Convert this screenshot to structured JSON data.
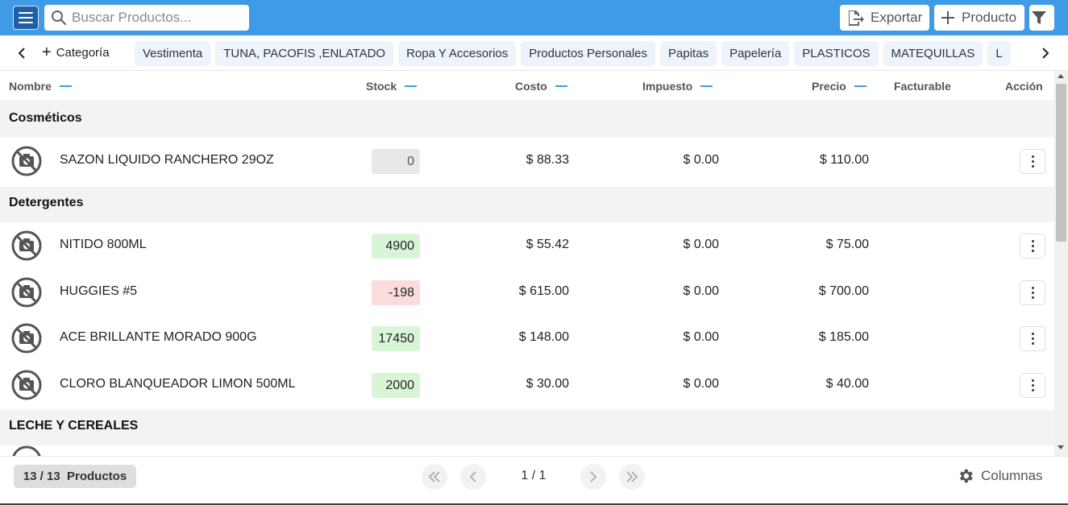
{
  "topbar": {
    "search_placeholder": "Buscar Productos...",
    "export_label": "Exportar",
    "product_label": "Producto"
  },
  "categories": {
    "add_label": "Categoría",
    "items": [
      "Vestimenta",
      "TUNA, PACOFIS ,ENLATADO",
      "Ropa Y Accesorios",
      "Productos Personales",
      "Papitas",
      "Papelería",
      "PLASTICOS",
      "MATEQUILLAS",
      "L"
    ]
  },
  "table": {
    "headers": {
      "nombre": "Nombre",
      "stock": "Stock",
      "costo": "Costo",
      "impuesto": "Impuesto",
      "precio": "Precio",
      "facturable": "Facturable",
      "accion": "Acción"
    },
    "groups": [
      {
        "name": "Cosméticos",
        "rows": [
          {
            "name": "SAZON LIQUIDO RANCHERO 29OZ",
            "stock": "0",
            "stock_state": "zero",
            "costo": "$ 88.33",
            "impuesto": "$ 0.00",
            "precio": "$ 110.00"
          }
        ]
      },
      {
        "name": "Detergentes",
        "rows": [
          {
            "name": "NITIDO 800ML",
            "stock": "4900",
            "stock_state": "pos",
            "costo": "$ 55.42",
            "impuesto": "$ 0.00",
            "precio": "$ 75.00"
          },
          {
            "name": "HUGGIES #5",
            "stock": "-198",
            "stock_state": "neg",
            "costo": "$ 615.00",
            "impuesto": "$ 0.00",
            "precio": "$ 700.00"
          },
          {
            "name": "ACE BRILLANTE MORADO 900G",
            "stock": "17450",
            "stock_state": "pos",
            "costo": "$ 148.00",
            "impuesto": "$ 0.00",
            "precio": "$ 185.00"
          },
          {
            "name": "CLORO BLANQUEADOR LIMON 500ML",
            "stock": "2000",
            "stock_state": "pos",
            "costo": "$ 30.00",
            "impuesto": "$ 0.00",
            "precio": "$ 40.00"
          }
        ]
      },
      {
        "name": "LECHE Y CEREALES",
        "rows": []
      }
    ]
  },
  "footer": {
    "count_label": "13 / 13  Productos",
    "page_label": "1 / 1",
    "columns_label": "Columnas"
  },
  "colors": {
    "topbar": "#3f9be6",
    "accent": "#3f9be6",
    "stock_positive": "#d9f5d8",
    "stock_negative": "#fadcdc",
    "stock_zero": "#e8e8e8"
  },
  "icons": [
    "menu-icon",
    "search-icon",
    "export-icon",
    "plus-icon",
    "filter-icon",
    "chevron-left-icon",
    "chevron-right-icon",
    "no-photo-icon",
    "more-vertical-icon",
    "first-page-icon",
    "last-page-icon",
    "gear-icon"
  ]
}
